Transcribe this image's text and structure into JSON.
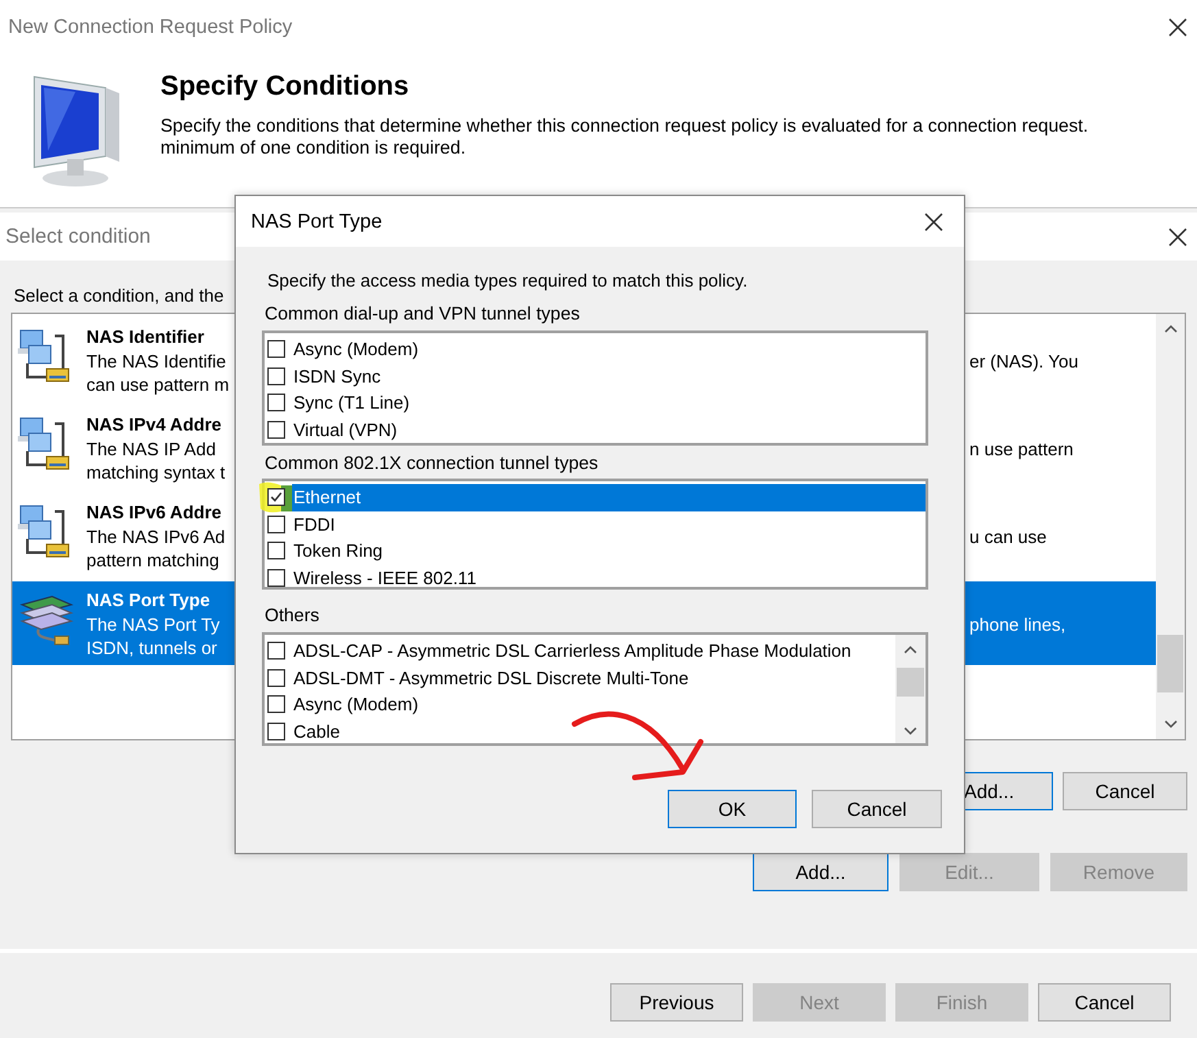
{
  "wizard": {
    "title": "New Connection Request Policy",
    "heading": "Specify Conditions",
    "description_lines": [
      "Specify the conditions that determine whether this connection request policy is evaluated for a connection request.",
      "minimum of one condition is required."
    ],
    "buttons": [
      {
        "label": "Add...",
        "disabled": false,
        "default": true
      },
      {
        "label": "Edit...",
        "disabled": true,
        "default": false
      },
      {
        "label": "Remove",
        "disabled": true,
        "default": false
      }
    ],
    "nav_buttons": [
      {
        "label": "Previous",
        "disabled": false,
        "default": false
      },
      {
        "label": "Next",
        "disabled": true,
        "default": false
      },
      {
        "label": "Finish",
        "disabled": true,
        "default": false
      },
      {
        "label": "Cancel",
        "disabled": false,
        "default": false
      }
    ]
  },
  "select_window": {
    "title": "Select condition",
    "prompt": "Select a condition, and the",
    "conditions": [
      {
        "kind": "network",
        "title": "NAS Identifier",
        "left_lines": [
          "The NAS Identifie",
          "can use pattern m"
        ],
        "right_lines": [
          "er (NAS). You"
        ],
        "selected": false
      },
      {
        "kind": "network",
        "title": "NAS IPv4 Addre",
        "left_lines": [
          "The NAS IP Add",
          "matching syntax t"
        ],
        "right_lines": [
          "n use pattern"
        ],
        "selected": false
      },
      {
        "kind": "network",
        "title": "NAS IPv6 Addre",
        "left_lines": [
          "The NAS IPv6 Ad",
          "pattern matching"
        ],
        "right_lines": [
          "u can use"
        ],
        "selected": false
      },
      {
        "kind": "port",
        "title": "NAS Port Type",
        "left_lines": [
          "The NAS Port Ty",
          "ISDN, tunnels or"
        ],
        "right_lines": [
          "phone lines,"
        ],
        "selected": true
      }
    ],
    "buttons": [
      {
        "label": "Add...",
        "disabled": false,
        "default": true
      },
      {
        "label": "Cancel",
        "disabled": false,
        "default": false
      }
    ]
  },
  "dialog": {
    "title": "NAS Port Type",
    "instruction": "Specify the access media types required to match this policy.",
    "groups": [
      {
        "label": "Common dial-up and VPN tunnel types",
        "items": [
          {
            "label": "Async (Modem)",
            "checked": false,
            "selected": false
          },
          {
            "label": "ISDN Sync",
            "checked": false,
            "selected": false
          },
          {
            "label": "Sync (T1 Line)",
            "checked": false,
            "selected": false
          },
          {
            "label": "Virtual (VPN)",
            "checked": false,
            "selected": false
          }
        ]
      },
      {
        "label": "Common 802.1X connection tunnel types",
        "items": [
          {
            "label": "Ethernet",
            "checked": true,
            "selected": true
          },
          {
            "label": "FDDI",
            "checked": false,
            "selected": false
          },
          {
            "label": "Token Ring",
            "checked": false,
            "selected": false
          },
          {
            "label": "Wireless - IEEE 802.11",
            "checked": false,
            "selected": false
          }
        ]
      },
      {
        "label": "Others",
        "items": [
          {
            "label": "ADSL-CAP - Asymmetric DSL Carrierless Amplitude Phase Modulation",
            "checked": false,
            "selected": false
          },
          {
            "label": "ADSL-DMT - Asymmetric DSL Discrete Multi-Tone",
            "checked": false,
            "selected": false
          },
          {
            "label": "Async (Modem)",
            "checked": false,
            "selected": false
          },
          {
            "label": "Cable",
            "checked": false,
            "selected": false
          }
        ]
      }
    ],
    "buttons": [
      {
        "label": "OK",
        "disabled": false,
        "default": true
      },
      {
        "label": "Cancel",
        "disabled": false,
        "default": false
      }
    ]
  }
}
